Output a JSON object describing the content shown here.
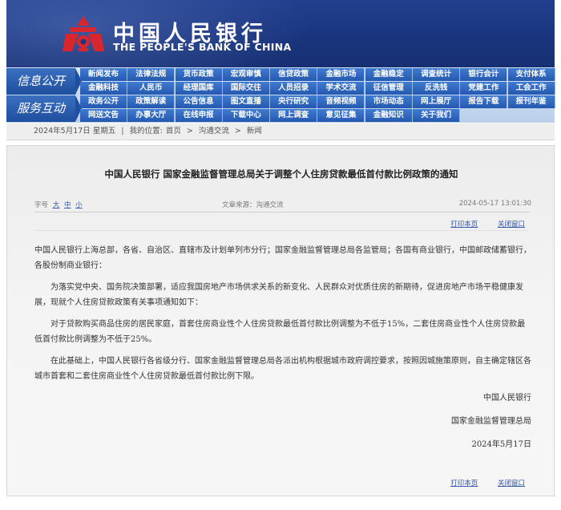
{
  "header": {
    "bank_name_cn": "中国人民银行",
    "bank_name_en": "THE PEOPLE'S BANK OF CHINA",
    "brand_color": "#1f3a86",
    "logo_color": "#d8262c"
  },
  "nav": {
    "group1_label": "信息公开",
    "group2_label": "服务互动",
    "group1_row1": [
      "新闻发布",
      "法律法规",
      "货币政策",
      "宏观审慎",
      "信贷政策",
      "金融市场",
      "金融稳定",
      "调查统计",
      "银行会计",
      "支付体系"
    ],
    "group1_row2": [
      "金融科技",
      "人民币",
      "经理国库",
      "国际交往",
      "人员招录",
      "学术交流",
      "征信管理",
      "反洗钱",
      "党建工作",
      "工会工作"
    ],
    "group2_row1": [
      "政务公开",
      "政策解读",
      "公告信息",
      "图文直播",
      "央行研究",
      "音频视频",
      "市场动态",
      "网上展厅",
      "报告下载",
      "报刊年鉴"
    ],
    "group2_row2": [
      "网送文告",
      "办事大厅",
      "在线申报",
      "下载中心",
      "网上调查",
      "意见征集",
      "金融知识",
      "关于我们"
    ]
  },
  "breadcrumb": {
    "date": "2024年5月17日 星期五",
    "location_label": "我的位置:",
    "items": [
      "首页",
      "沟通交流",
      "新闻"
    ]
  },
  "article": {
    "title": "中国人民银行 国家金融监督管理总局关于调整个人住房贷款最低首付款比例政策的通知",
    "font_size_label": "字号",
    "font_sizes": [
      "大",
      "中",
      "小"
    ],
    "source": "文章来源：沟通交流",
    "datetime": "2024-05-17 13:01:30",
    "print_label": "打印本页",
    "close_label": "关闭窗口",
    "p1": "中国人民银行上海总部，各省、自治区、直辖市及计划单列市分行；国家金融监督管理总局各监管局；各国有商业银行，中国邮政储蓄银行，各股份制商业银行：",
    "p2": "为落实党中央、国务院决策部署，适应我国房地产市场供求关系的新变化、人民群众对优质住房的新期待，促进房地产市场平稳健康发展，现就个人住房贷款政策有关事项通知如下：",
    "p3": "对于贷款购买商品住房的居民家庭，首套住房商业性个人住房贷款最低首付款比例调整为不低于15%，二套住房商业性个人住房贷款最低首付款比例调整为不低于25%。",
    "p4": "在此基础上，中国人民银行各省级分行、国家金融监督管理总局各派出机构根据城市政府调控要求，按照因城施策原则，自主确定辖区各城市首套和二套住房商业性个人住房贷款最低首付款比例下限。",
    "sig1": "中国人民银行",
    "sig2": "国家金融监督管理总局",
    "sig_date": "2024年5月17日"
  }
}
